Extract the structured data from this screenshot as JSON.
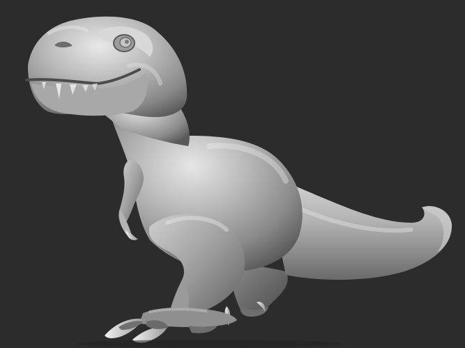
{
  "scene": {
    "background_color": "#2c2c2c",
    "model_color": "#a6a6a6",
    "highlight_color": "#e4e4e4",
    "shadow_color": "#4a4a4a",
    "outline_color": "#3a3a3a",
    "subject": "t-rex-sculpt",
    "render_style": "clay-matcap"
  }
}
